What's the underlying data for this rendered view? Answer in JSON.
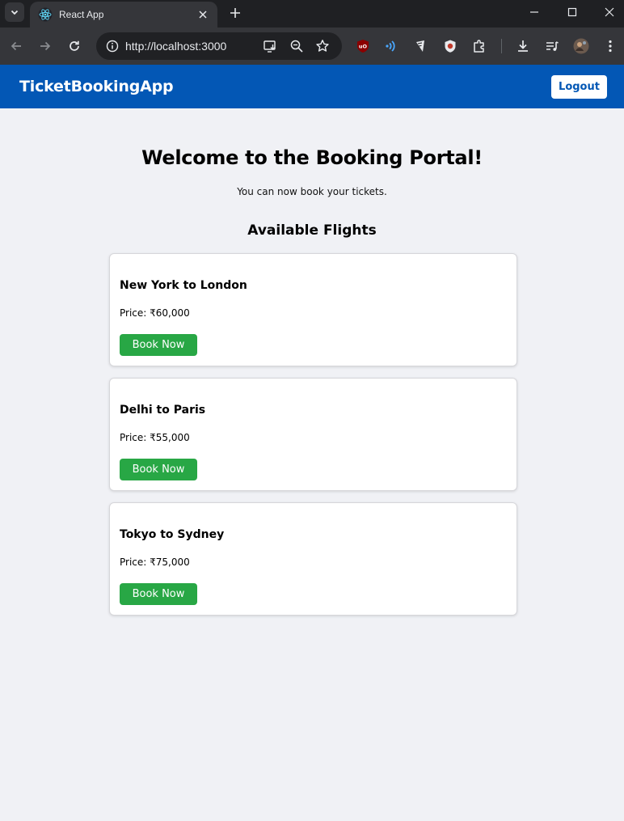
{
  "browser": {
    "tab_title": "React App",
    "url": "http://localhost:3000"
  },
  "app": {
    "brand": "TicketBookingApp",
    "logout_label": "Logout",
    "welcome_title": "Welcome to the Booking Portal!",
    "welcome_subtitle": "You can now book your tickets.",
    "section_title": "Available Flights",
    "flights": [
      {
        "route": "New York to London",
        "price": "Price: ₹60,000",
        "button": "Book Now"
      },
      {
        "route": "Delhi to Paris",
        "price": "Price: ₹55,000",
        "button": "Book Now"
      },
      {
        "route": "Tokyo to Sydney",
        "price": "Price: ₹75,000",
        "button": "Book Now"
      }
    ]
  },
  "colors": {
    "navbar": "#0357b5",
    "page_background": "#f0f1f5",
    "book_button": "#28a745",
    "browser_tabbar": "#1f2023",
    "browser_toolbar": "#35363a"
  },
  "icons": {
    "tab_list": "chevron-down-icon",
    "favicon": "react-logo-icon",
    "tab_close": "close-icon",
    "new_tab": "plus-icon",
    "window_controls": [
      "minimize-icon",
      "maximize-icon",
      "window-close-icon"
    ],
    "nav": [
      "back-arrow-icon",
      "forward-arrow-icon",
      "reload-icon"
    ],
    "omnibox": [
      "site-info-icon",
      "install-app-icon",
      "zoom-icon",
      "bookmark-star-icon"
    ],
    "extensions": [
      "ublock-icon",
      "signal-extension-icon",
      "extension-icon",
      "shield-extension-icon",
      "puzzle-icon",
      "download-icon",
      "media-control-icon",
      "profile-avatar-icon",
      "more-menu-icon"
    ]
  }
}
